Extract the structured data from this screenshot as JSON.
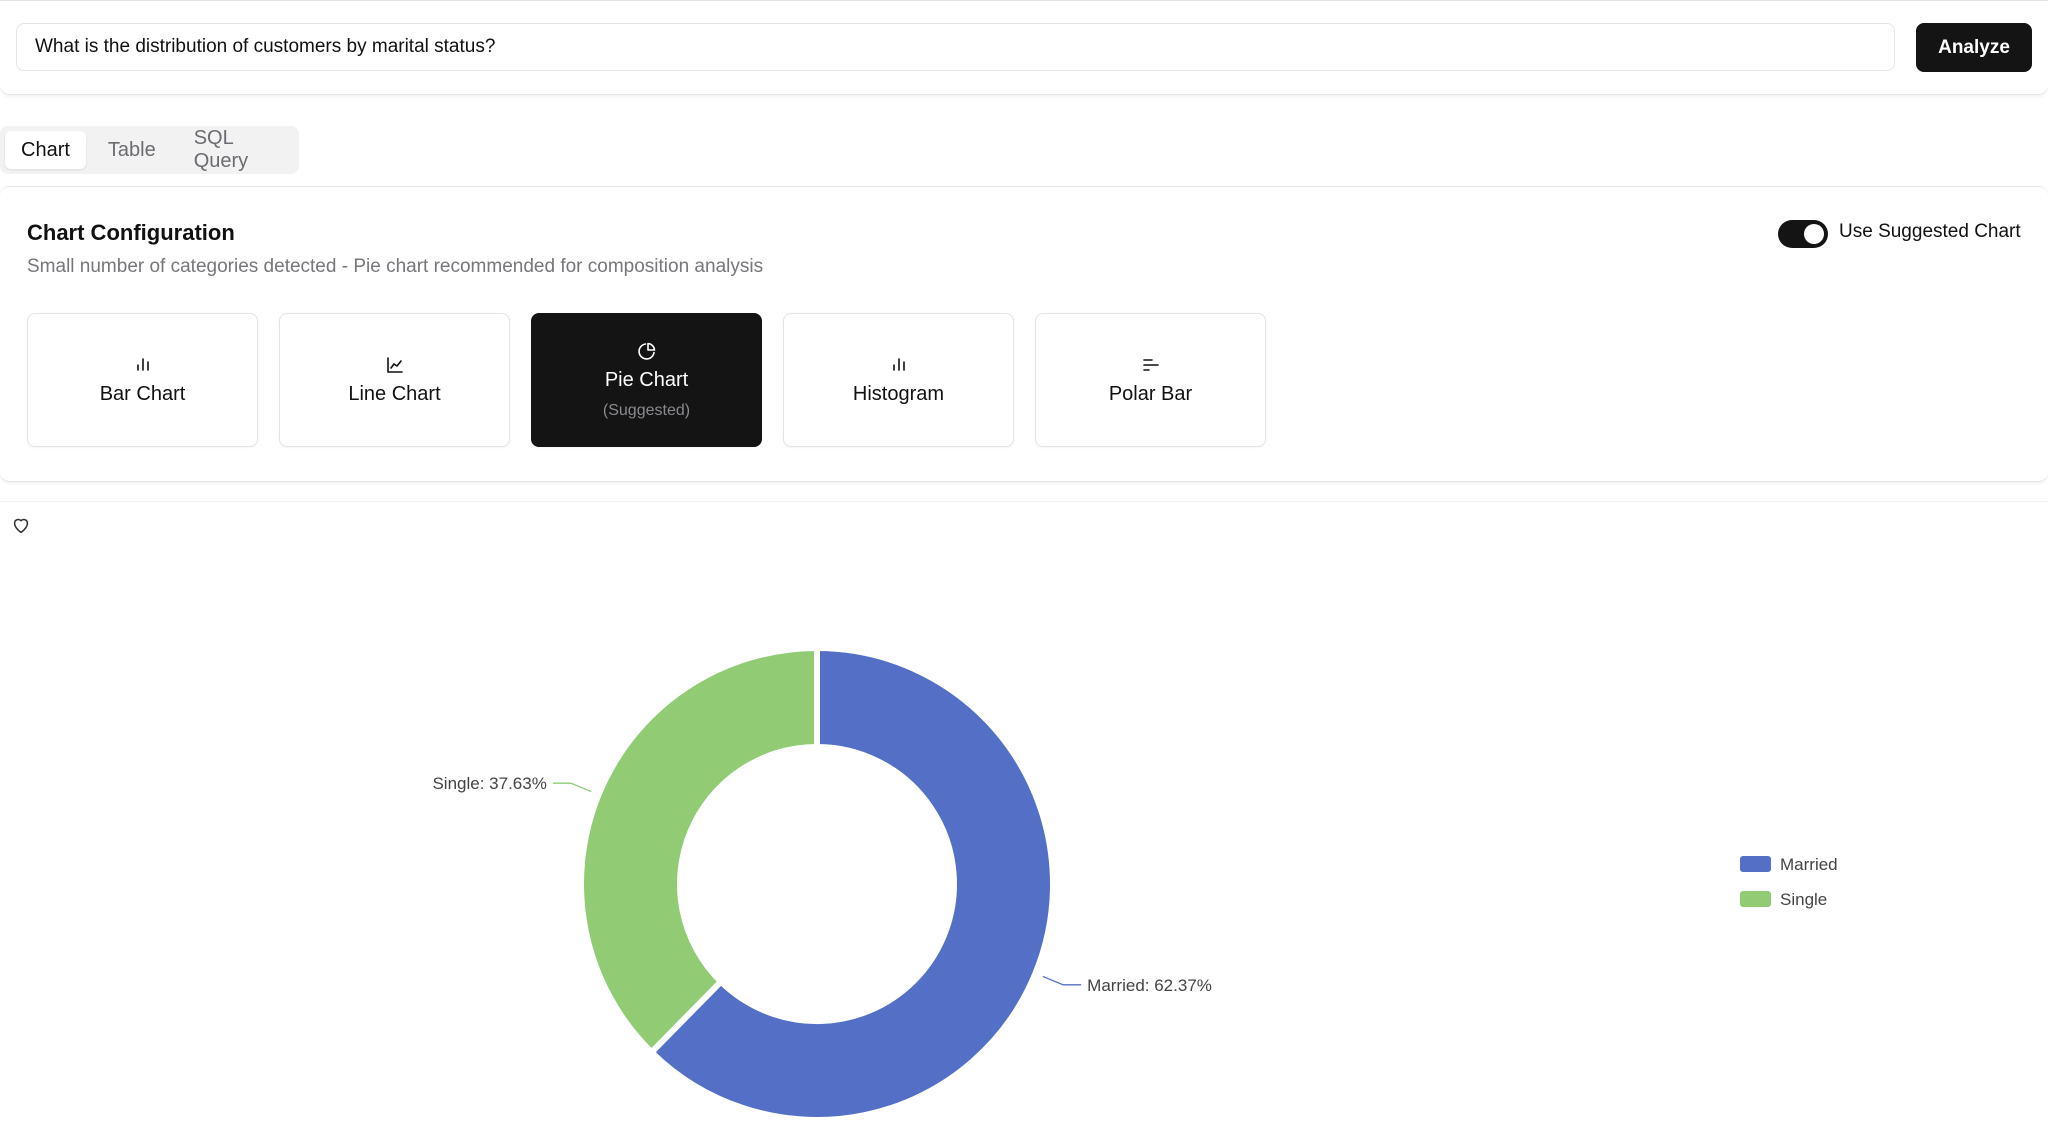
{
  "query": {
    "value": "What is the distribution of customers by marital status?",
    "analyze_label": "Analyze"
  },
  "tabs": [
    {
      "label": "Chart",
      "active": true
    },
    {
      "label": "Table",
      "active": false
    },
    {
      "label": "SQL Query",
      "active": false
    }
  ],
  "config": {
    "title": "Chart Configuration",
    "description": "Small number of categories detected - Pie chart recommended for composition analysis",
    "toggle_label": "Use Suggested Chart",
    "toggle_on": true,
    "options": [
      {
        "label": "Bar Chart",
        "icon": "bar-chart-icon"
      },
      {
        "label": "Line Chart",
        "icon": "line-chart-icon"
      },
      {
        "label": "Pie Chart",
        "icon": "pie-chart-icon",
        "sub": "(Suggested)",
        "selected": true
      },
      {
        "label": "Histogram",
        "icon": "histogram-icon"
      },
      {
        "label": "Polar Bar",
        "icon": "polar-bar-icon"
      }
    ]
  },
  "favorite_icon": "heart-icon",
  "chart_data": {
    "type": "pie",
    "donut": true,
    "categories": [
      "Married",
      "Single"
    ],
    "values": [
      62.37,
      37.63
    ],
    "colors": [
      "#5470c6",
      "#91cc75"
    ],
    "labels": [
      "Married: 62.37%",
      "Single: 37.63%"
    ],
    "legend": [
      "Married",
      "Single"
    ],
    "legend_position": "right"
  }
}
